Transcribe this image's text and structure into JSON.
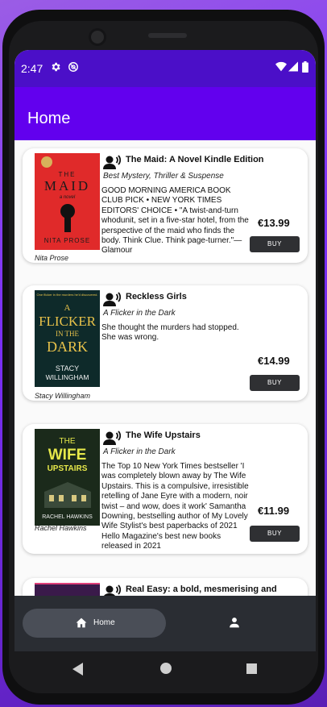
{
  "status_bar": {
    "time": "2:47",
    "icons": [
      "gear-icon",
      "at-sign-icon",
      "wifi-icon",
      "signal-icon",
      "battery-icon"
    ]
  },
  "app_bar": {
    "title": "Home"
  },
  "books": [
    {
      "title": "The Maid: A Novel Kindle Edition",
      "subtitle": "Best Mystery, Thriller & Suspense",
      "description": "GOOD MORNING AMERICA BOOK CLUB PICK • NEW YORK TIMES EDITORS' CHOICE • \"A twist-and-turn whodunit, set in a five-star hotel, from the perspective of the maid who finds the body. Think Clue. Think page-turner.\"—Glamour",
      "price": "€13.99",
      "buy_label": "BUY",
      "author": "Nita Prose",
      "cover": {
        "title_top": "THE",
        "title_main": "MAID",
        "byline": "a novel",
        "author_line": "NITA PROSE",
        "color": "#e02a2a"
      }
    },
    {
      "title": "Reckless Girls",
      "subtitle": "A Flicker in the Dark",
      "description": "She thought the murders had stopped. She was wrong.",
      "price": "€14.99",
      "buy_label": "BUY",
      "author": "Stacy Willingham",
      "cover": {
        "tagline": "One flicker in the murders he'd discovered.",
        "title_a": "A",
        "title_b": "FLICKER",
        "title_c": "IN THE",
        "title_d": "DARK",
        "author_a": "STACY",
        "author_b": "WILLINGHAM",
        "color": "#0e2a2a"
      }
    },
    {
      "title": "The Wife Upstairs",
      "subtitle": "A Flicker in the Dark",
      "description": "The Top 10 New York Times bestseller 'I was completely blown away by The Wife Upstairs. This is a compulsive, irresistible retelling of Jane Eyre with a modern, noir twist – and wow, does it work' Samantha Downing, bestselling author of My Lovely Wife Stylist's best paperbacks of 2021 Hello Magazine's best new books released in 2021",
      "price": "€11.99",
      "buy_label": "BUY",
      "author": "Rachel Hawkins",
      "cover": {
        "title_a": "THE",
        "title_b": "WIFE",
        "title_c": "UPSTAIRS",
        "author_line": "RACHEL HAWKINS",
        "color": "#1b2a1b"
      }
    },
    {
      "title": "Real Easy: a bold, mesmerising and",
      "author": ""
    }
  ],
  "bottom_nav": {
    "home_label": "Home",
    "home_icon": "home-icon",
    "profile_icon": "person-icon"
  },
  "system_nav": [
    "back-icon",
    "home-circle-icon",
    "recents-icon"
  ],
  "colors": {
    "status_bar": "#4b0fc8",
    "app_bar": "#6200ee",
    "bottom_bar": "#2a2d33",
    "buy_button": "#2f3033"
  }
}
